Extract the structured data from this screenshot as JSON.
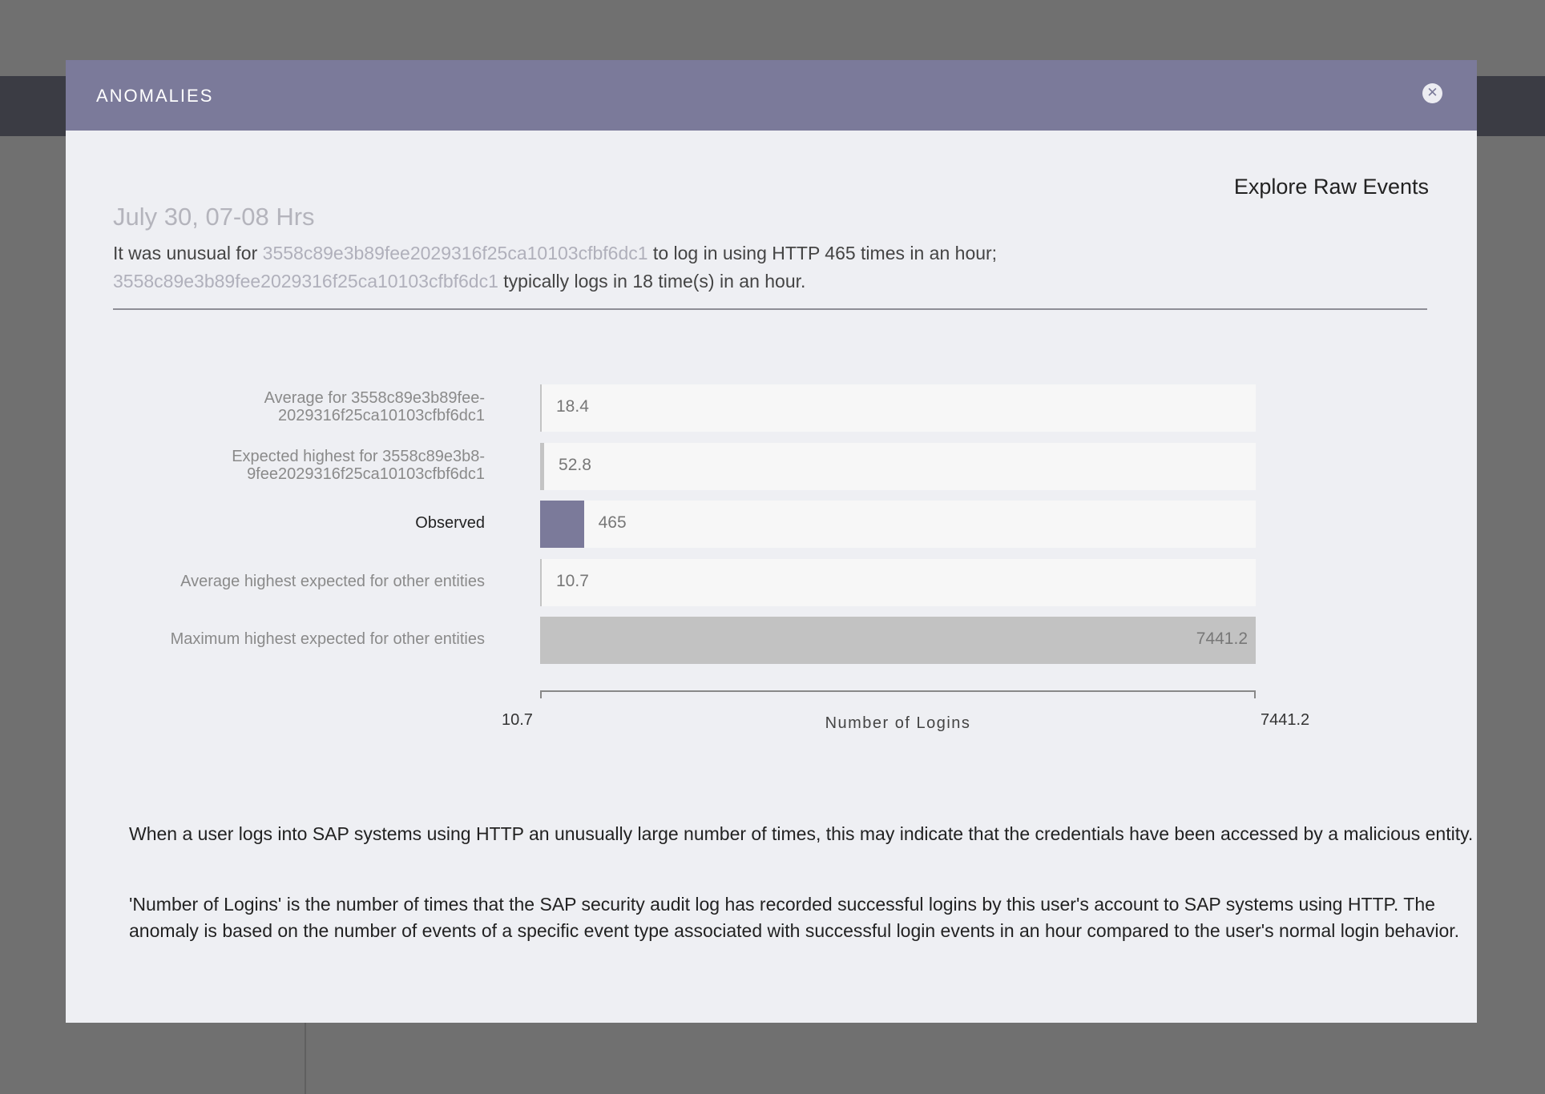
{
  "modal": {
    "title": "ANOMALIES",
    "close_icon": "close-icon",
    "explore_label": "Explore Raw Events",
    "date_heading": "July 30, 07-08 Hrs",
    "summary": {
      "part1": "It was unusual for ",
      "entity1": "3558c89e3b89fee2029316f25ca10103cfbf6dc1",
      "part2": " to log in using HTTP 465 times in an hour;",
      "entity2": "3558c89e3b89fee2029316f25ca10103cfbf6dc1",
      "part3": " typically logs in 18 time(s) in an hour."
    },
    "description": [
      "When a user logs into SAP systems using HTTP an unusually large number of times, this may indicate that the credentials have been accessed by a malicious entity.",
      "'Number of Logins' is the number of times that the SAP security audit log has recorded successful logins by this user's account to SAP systems using HTTP. The anomaly is based on the number of events of a specific event type associated with successful login events in an hour compared to the user's normal login behavior."
    ]
  },
  "chart_data": {
    "type": "bar",
    "orientation": "horizontal",
    "xlabel": "Number of Logins",
    "xlim": [
      10.7,
      7441.2
    ],
    "tick_labels": [
      "10.7",
      "7441.2"
    ],
    "categories": [
      "Average for 3558c89e3b89fee- 2029316f25ca10103cfbf6dc1",
      "Expected highest for 3558c89e3b8- 9fee2029316f25ca10103cfbf6dc1",
      "Observed",
      "Average highest expected for other entities",
      "Maximum highest expected for other entities"
    ],
    "label_lines": [
      [
        "Average for 3558c89e3b89fee-",
        "2029316f25ca10103cfbf6dc1"
      ],
      [
        "Expected highest for 3558c89e3b8-",
        "9fee2029316f25ca10103cfbf6dc1"
      ],
      [
        "Observed"
      ],
      [
        "Average highest expected for other entities"
      ],
      [
        "Maximum highest expected for other entities"
      ]
    ],
    "values": [
      18.4,
      52.8,
      465,
      10.7,
      7441.2
    ],
    "value_labels": [
      "18.4",
      "52.8",
      "465",
      "10.7",
      "7441.2"
    ],
    "colors": [
      "#c4c4c4",
      "#c4c4c4",
      "#7b7a9a",
      "#c4c4c4",
      "#c2c2c2"
    ],
    "highlight_index": 2
  }
}
